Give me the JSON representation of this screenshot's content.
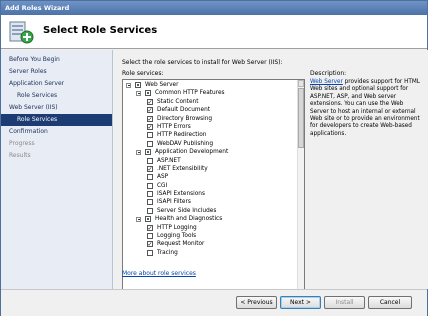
{
  "window": {
    "title": "Add Roles Wizard"
  },
  "header": {
    "title": "Select Role Services",
    "icon": "role-services-icon"
  },
  "nav": {
    "items": [
      {
        "label": "Before You Begin",
        "state": "normal",
        "sub": false
      },
      {
        "label": "Server Roles",
        "state": "normal",
        "sub": false
      },
      {
        "label": "Application Server",
        "state": "normal",
        "sub": false
      },
      {
        "label": "Role Services",
        "state": "normal",
        "sub": true
      },
      {
        "label": "Web Server (IIS)",
        "state": "normal",
        "sub": false
      },
      {
        "label": "Role Services",
        "state": "active",
        "sub": true
      },
      {
        "label": "Confirmation",
        "state": "normal",
        "sub": false
      },
      {
        "label": "Progress",
        "state": "disabled",
        "sub": false
      },
      {
        "label": "Results",
        "state": "disabled",
        "sub": false
      }
    ]
  },
  "main": {
    "instruction": "Select the role services to install for Web Server (IIS):",
    "role_services_label": "Role services:",
    "more_link": "More about role services",
    "tree": [
      {
        "label": "Web Server",
        "level": 0,
        "state": "partial",
        "expander": true
      },
      {
        "label": "Common HTTP Features",
        "level": 1,
        "state": "partial",
        "expander": true
      },
      {
        "label": "Static Content",
        "level": 2,
        "state": "checked",
        "expander": false
      },
      {
        "label": "Default Document",
        "level": 2,
        "state": "checked",
        "expander": false
      },
      {
        "label": "Directory Browsing",
        "level": 2,
        "state": "checked",
        "expander": false
      },
      {
        "label": "HTTP Errors",
        "level": 2,
        "state": "checked",
        "expander": false
      },
      {
        "label": "HTTP Redirection",
        "level": 2,
        "state": "unchecked",
        "expander": false
      },
      {
        "label": "WebDAV Publishing",
        "level": 2,
        "state": "unchecked",
        "expander": false
      },
      {
        "label": "Application Development",
        "level": 1,
        "state": "partial",
        "expander": true
      },
      {
        "label": "ASP.NET",
        "level": 2,
        "state": "unchecked",
        "expander": false
      },
      {
        "label": ".NET Extensibility",
        "level": 2,
        "state": "checked",
        "expander": false
      },
      {
        "label": "ASP",
        "level": 2,
        "state": "unchecked",
        "expander": false
      },
      {
        "label": "CGI",
        "level": 2,
        "state": "unchecked",
        "expander": false
      },
      {
        "label": "ISAPI Extensions",
        "level": 2,
        "state": "unchecked",
        "expander": false
      },
      {
        "label": "ISAPI Filters",
        "level": 2,
        "state": "unchecked",
        "expander": false
      },
      {
        "label": "Server Side Includes",
        "level": 2,
        "state": "unchecked",
        "expander": false
      },
      {
        "label": "Health and Diagnostics",
        "level": 1,
        "state": "partial",
        "expander": true
      },
      {
        "label": "HTTP Logging",
        "level": 2,
        "state": "checked",
        "expander": false
      },
      {
        "label": "Logging Tools",
        "level": 2,
        "state": "unchecked",
        "expander": false
      },
      {
        "label": "Request Monitor",
        "level": 2,
        "state": "checked",
        "expander": false
      },
      {
        "label": "Tracing",
        "level": 2,
        "state": "unchecked",
        "expander": false
      }
    ],
    "description": {
      "label": "Description:",
      "link": "Web Server",
      "text": " provides support for HTML Web sites and optional support for ASP.NET, ASP, and Web server extensions. You can use the Web Server to host an internal or external Web site or to provide an environment for developers to create Web-based applications."
    }
  },
  "footer": {
    "previous_label": "< Previous",
    "next_label": "Next >",
    "install_label": "Install",
    "cancel_label": "Cancel"
  }
}
